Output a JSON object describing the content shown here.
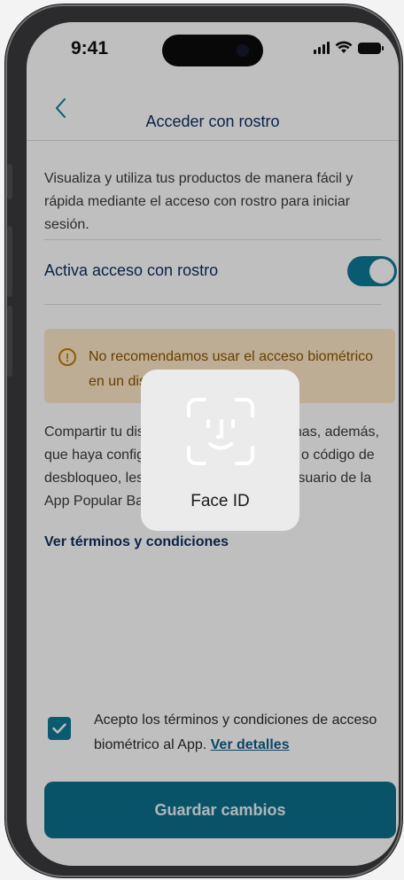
{
  "status_bar": {
    "time": "9:41"
  },
  "nav": {
    "title": "Acceder con rostro"
  },
  "description": "Visualiza y utiliza tus productos de manera fácil y rápida mediante el acceso con rostro para iniciar sesión.",
  "toggle": {
    "label": "Activa acceso con rostro",
    "on": true
  },
  "warning": {
    "text": "No recomendamos usar el acceso biométrico en un dispositivo."
  },
  "consent_text": "Compartir tu dispositivo con otras personas, además, que haya configurado su rostro o huella, o código de desbloqueo, les permite el acceso a tu usuario de la App Popular Bank.",
  "terms_link": "Ver términos y condiciones",
  "acceptance": {
    "checked": true,
    "text": "Acepto los términos y condiciones de acceso biométrico al App.",
    "link": "Ver detalles"
  },
  "save_button": "Guardar cambios",
  "faceid": {
    "label": "Face ID"
  },
  "colors": {
    "primary": "#0d7a96",
    "title": "#0e2e5e",
    "warning_bg": "#fbe7c6",
    "warning_text": "#8a5400"
  }
}
